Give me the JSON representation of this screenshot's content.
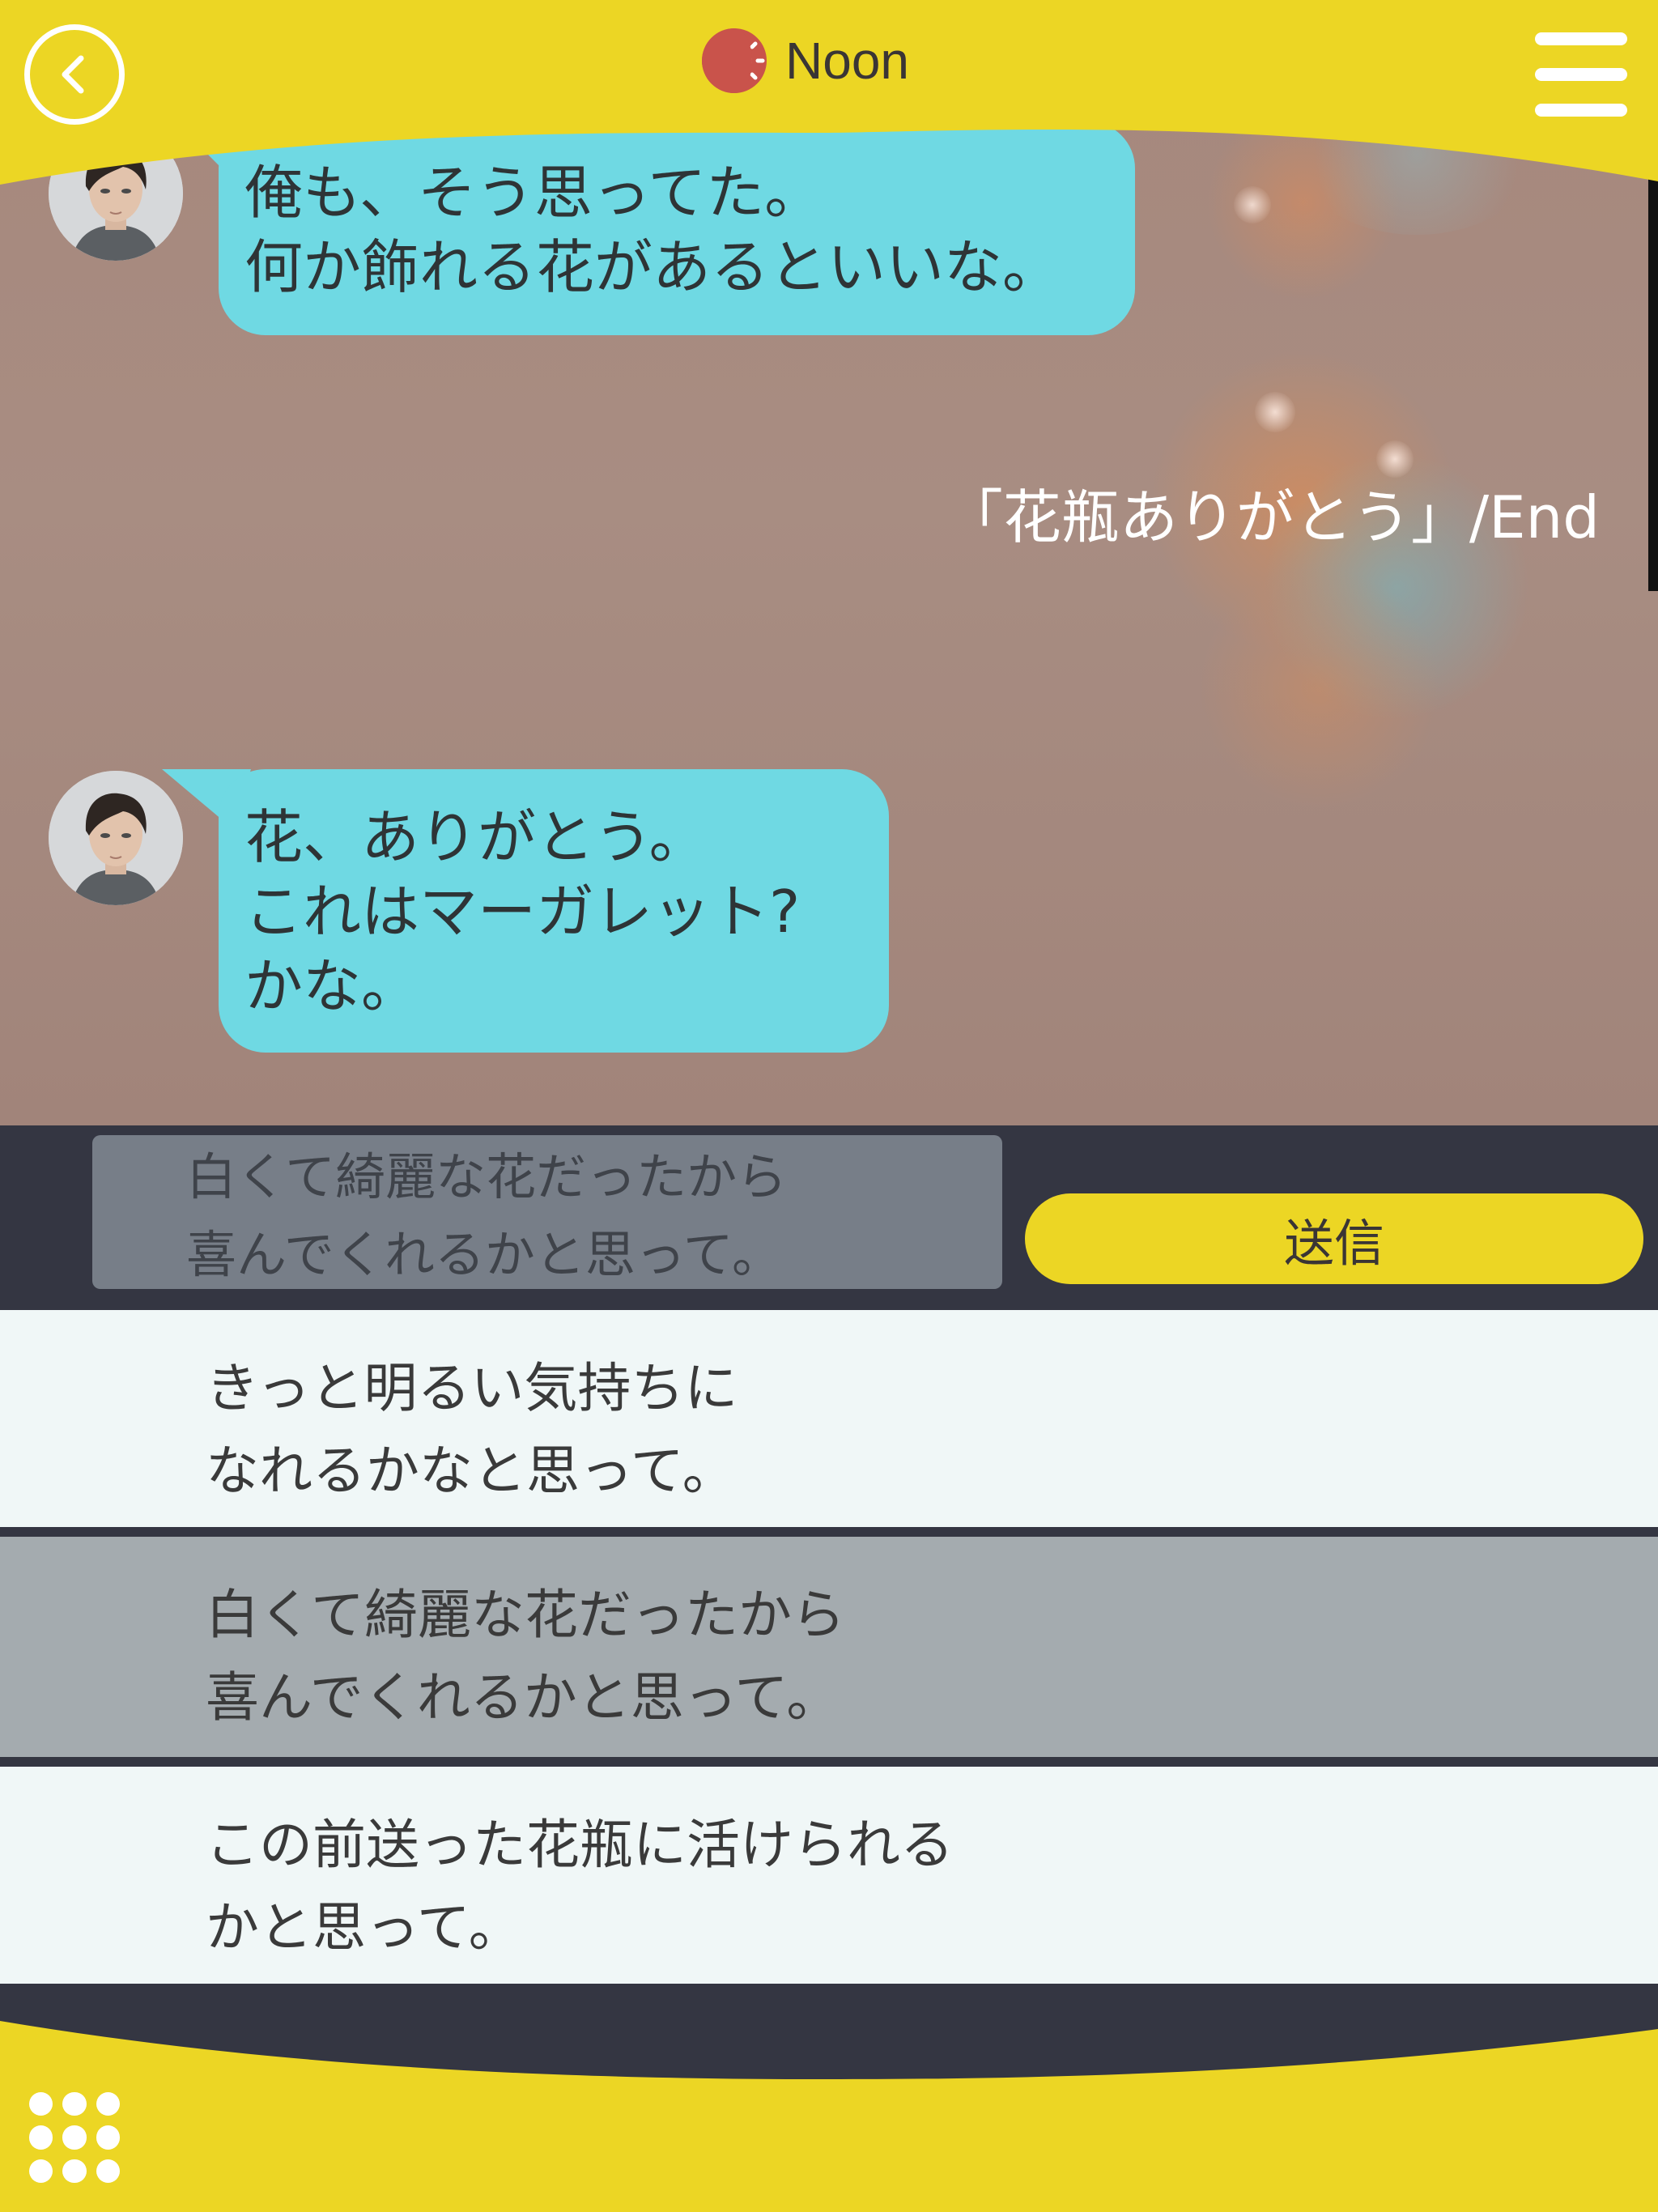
{
  "header": {
    "time_of_day": "Noon",
    "time_icon": "sun-clock-icon",
    "back_icon": "chevron-left-icon",
    "menu_icon": "hamburger-menu-icon"
  },
  "messages": [
    {
      "sender": "character",
      "lines": "俺も、そう思ってた。\n何か飾れる花があるといいな。"
    },
    {
      "sender": "character",
      "lines": "花、ありがとう。\nこれはマーガレット?\nかな。"
    }
  ],
  "story_end_label": "「花瓶ありがとう」/End",
  "input": {
    "value": "白くて綺麗な花だったから\n喜んでくれるかと思って。",
    "send_label": "送信"
  },
  "choices": [
    {
      "label": "きっと明るい気持ちに\nなれるかなと思って。",
      "selected": false
    },
    {
      "label": "白くて綺麗な花だったから\n喜んでくれるかと思って。",
      "selected": true
    },
    {
      "label": "この前送った花瓶に活けられる\nかと思って。",
      "selected": false
    }
  ],
  "footer": {
    "grid_icon": "apps-grid-icon"
  },
  "colors": {
    "header_yellow": "#ecd624",
    "bubble_cyan": "#6fd9e3",
    "dark_bar": "#343642",
    "choice_light": "#f0f7f7",
    "choice_selected": "#a4abaf",
    "input_gray": "#777e88",
    "chat_background": "#a6877c"
  }
}
